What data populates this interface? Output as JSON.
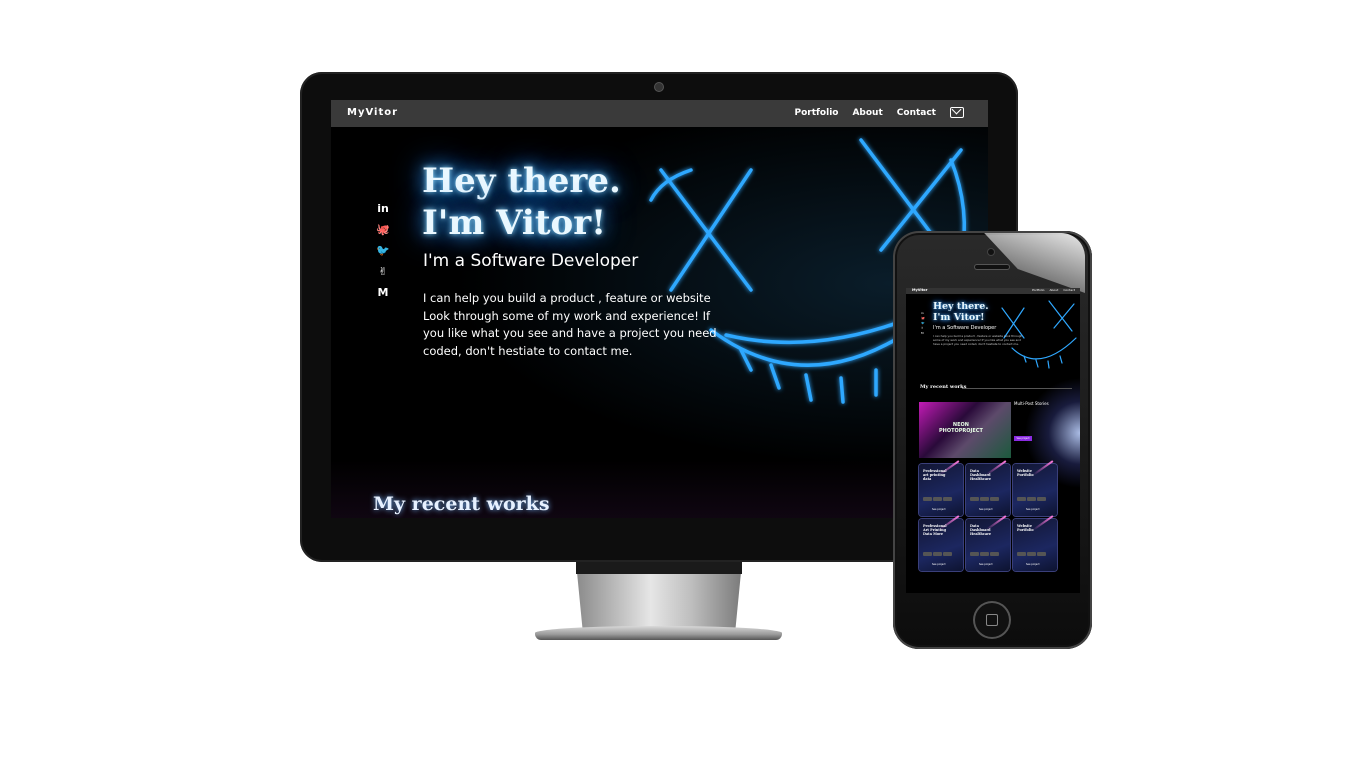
{
  "desktop": {
    "nav": {
      "brand": "MyVitor",
      "links": [
        "Portfolio",
        "About",
        "Contact"
      ],
      "contact_icon": "mail-icon"
    },
    "social_icons": [
      "linkedin-icon",
      "github-icon",
      "twitter-icon",
      "angellist-icon",
      "medium-icon"
    ],
    "social_glyphs": [
      "in",
      "🐙",
      "🐦",
      "✌",
      "M"
    ],
    "hero": {
      "title_line1": "Hey there.",
      "title_line2": "I'm Vitor!",
      "subtitle": "I'm a Software Developer",
      "description": "I can help you build a product , feature or website Look through some of my work and experience! If you like what you see and have a project you need coded, don't hestiate to contact me."
    },
    "recent_title": "My recent works"
  },
  "phone": {
    "nav": {
      "brand": "MyVitor",
      "links": [
        "Portfolio",
        "About",
        "Contact"
      ]
    },
    "hero": {
      "title_line1": "Hey there.",
      "title_line2": "I'm Vitor!",
      "subtitle": "I'm a Software Developer"
    },
    "recent_title": "My recent works",
    "featured": {
      "image_text": "NEON\nPHOTOPROJECT",
      "title": "Multi-Post Stories",
      "button": "See project"
    },
    "cards": [
      {
        "title": "Professional art printing data",
        "button": "See project"
      },
      {
        "title": "Data Dashboard Healthcare",
        "button": "See project"
      },
      {
        "title": "Website Portfolio",
        "button": "See project"
      },
      {
        "title": "Professional Art Printing Data More",
        "button": "See project"
      },
      {
        "title": "Data Dashboard Healthcare",
        "button": "See project"
      },
      {
        "title": "Website Portfolio",
        "button": "See project"
      }
    ]
  },
  "colors": {
    "accent_glow": "#36a9ff",
    "mask_neon": "#2fa8ff",
    "nav_bg": "#3a3a3a",
    "button_purple": "#8a2be2"
  }
}
